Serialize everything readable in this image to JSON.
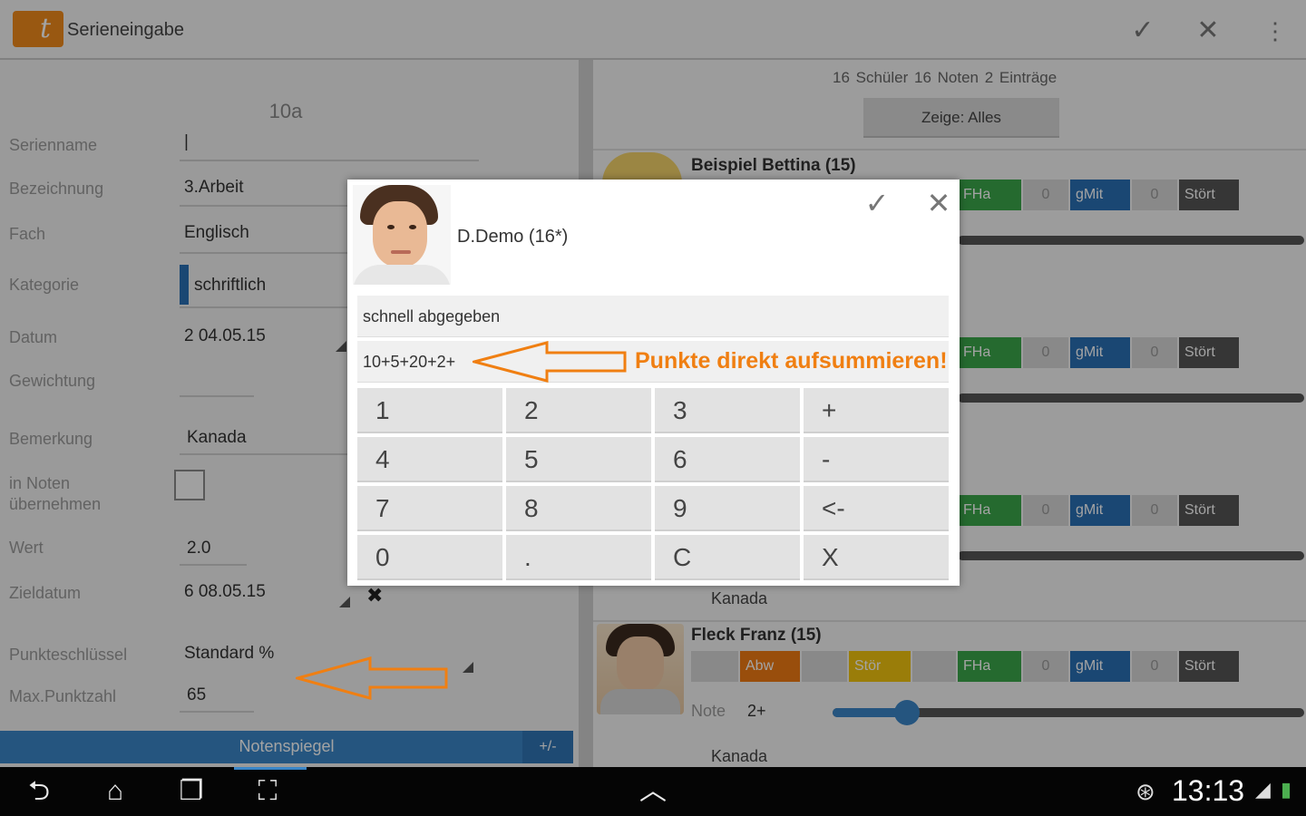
{
  "app": {
    "title": "Serieneingabe"
  },
  "actionbar": {
    "confirm_icon": "checkmark-icon",
    "close_icon": "close-icon",
    "overflow_icon": "overflow-menu-icon"
  },
  "form": {
    "class_name": "10a",
    "labels": {
      "serienname": "Serienname",
      "bezeichnung": "Bezeichnung",
      "fach": "Fach",
      "kategorie": "Kategorie",
      "datum": "Datum",
      "gewichtung": "Gewichtung",
      "bemerkung": "Bemerkung",
      "in_noten_1": "in Noten",
      "in_noten_2": "übernehmen",
      "wert": "Wert",
      "zieldatum": "Zieldatum",
      "punkteschluessel": "Punkteschlüssel",
      "max_punktzahl": "Max.Punktzahl"
    },
    "values": {
      "serienname": "|",
      "bezeichnung": "3.Arbeit",
      "fach": "Englisch",
      "kategorie": "schriftlich",
      "datum": "2 04.05.15",
      "gewichtung": "",
      "bemerkung": "Kanada",
      "wert": "2.0",
      "zieldatum": "6 08.05.15",
      "punkteschluessel": "Standard %",
      "max_punktzahl": "65"
    },
    "notenspiegel": "Notenspiegel",
    "notenspiegel_pm": "+/-"
  },
  "list": {
    "stats": "16 Schüler   16 Noten   2 Einträge",
    "filter_button": "Zeige: Alles",
    "students": [
      {
        "name": "Beispiel  Bettina  (15)"
      },
      {
        "name": "Fleck  Franz  (15)",
        "note_label": "Note",
        "note_value": "2+",
        "note_level": 0.08
      }
    ],
    "chips": {
      "abw": "Abw",
      "stoer_y": "Stör",
      "fha": "FHa",
      "zero": "0",
      "gmit": "gMit",
      "stoert": "Stört"
    },
    "remark": "Kanada"
  },
  "dialog": {
    "student_name": "D.Demo (16*)",
    "remark_value": "schnell abgegeben",
    "points_value": "10+5+20+2+",
    "annotation": "Punkte direkt aufsummieren!",
    "keys": [
      "1",
      "2",
      "3",
      "+",
      "4",
      "5",
      "6",
      "-",
      "7",
      "8",
      "9",
      "<-",
      "0",
      ".",
      "C",
      "X"
    ]
  },
  "system": {
    "time": "13:13",
    "nav_icons": [
      "back-icon",
      "home-icon",
      "recent-apps-icon",
      "screenshot-icon",
      "up-chevron-icon"
    ]
  },
  "colors": {
    "accent": "#3b86c7",
    "annotation": "#f07f12",
    "green": "#3aa64a",
    "blue": "#2a6fb5"
  }
}
